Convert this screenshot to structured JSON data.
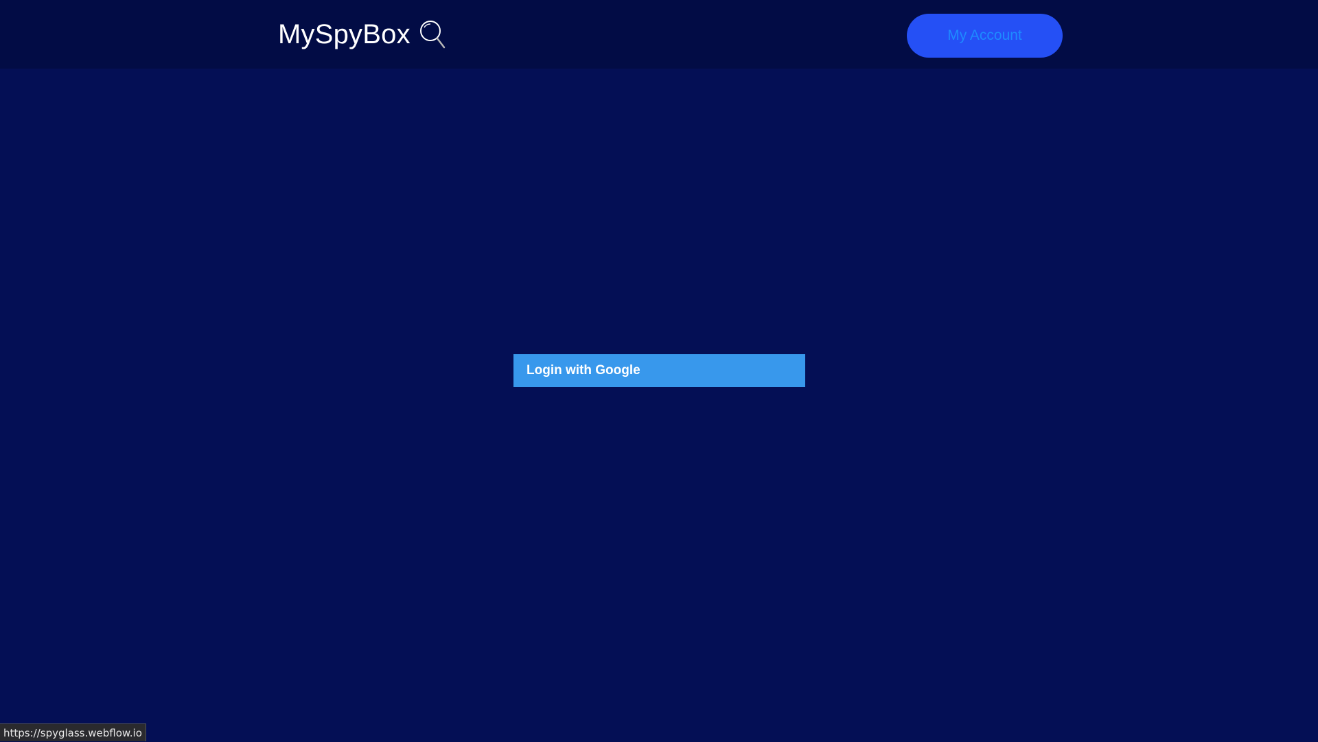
{
  "header": {
    "brand_name": "MySpyBox",
    "brand_icon": "magnifier-icon",
    "account_button_label": "My Account"
  },
  "main": {
    "login_button_label": "Login with Google"
  },
  "status_bar": {
    "url": "https://spyglass.webflow.io"
  },
  "colors": {
    "page_background": "#040f55",
    "navbar_background": "#020c45",
    "account_button_bg": "#2550f5",
    "account_button_text": "#1e8bff",
    "login_button_bg": "#3898ec"
  }
}
